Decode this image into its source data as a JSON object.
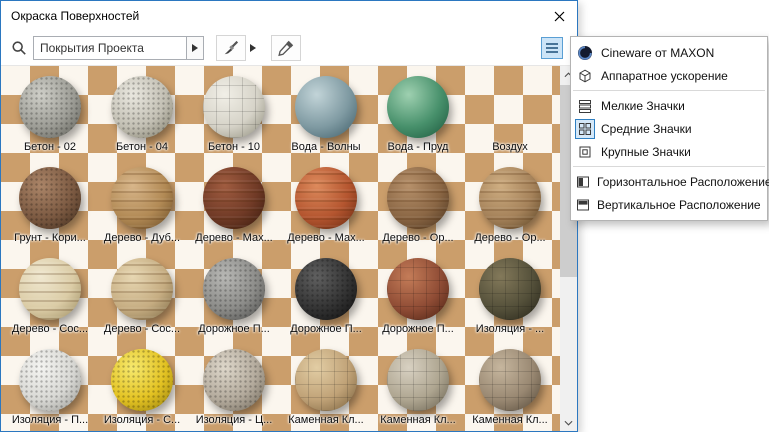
{
  "window": {
    "title": "Окраска Поверхностей"
  },
  "toolbar": {
    "search_value": "Покрытия Проекта"
  },
  "colors": {
    "accent": "#2b77c0",
    "checker_light": "#fbf6ee",
    "checker_dark": "#cb9e6b"
  },
  "materials": [
    {
      "label": "Бетон - 02",
      "light": "#cfcfc8",
      "base": "#9d9d96",
      "dark": "#63635c",
      "texture": "speckle"
    },
    {
      "label": "Бетон - 04",
      "light": "#e9e7df",
      "base": "#c3c0b4",
      "dark": "#84816f",
      "texture": "speckle"
    },
    {
      "label": "Бетон - 10",
      "light": "#f1efe7",
      "base": "#d6d3c8",
      "dark": "#92907f",
      "texture": "tiles"
    },
    {
      "label": "Вода - Волны",
      "light": "#c2d4d8",
      "base": "#7f9aa2",
      "dark": "#41606b"
    },
    {
      "label": "Вода - Пруд",
      "light": "#9ed0b0",
      "base": "#47906b",
      "dark": "#1e5a3f"
    },
    {
      "label": "Воздух",
      "transparent": true
    },
    {
      "label": "Грунт - Кори...",
      "light": "#ab8568",
      "base": "#7c5a42",
      "dark": "#45301f",
      "texture": "speckle"
    },
    {
      "label": "Дерево - Дуб...",
      "light": "#d8b68a",
      "base": "#b28a55",
      "dark": "#6e4f28",
      "texture": "stripes"
    },
    {
      "label": "Дерево - Мах...",
      "light": "#a05c40",
      "base": "#703a26",
      "dark": "#3a1b0e",
      "texture": "stripes"
    },
    {
      "label": "Дерево - Мах...",
      "light": "#dd8a5c",
      "base": "#b4552f",
      "dark": "#6b2a12",
      "texture": "stripes"
    },
    {
      "label": "Дерево - Ор...",
      "light": "#b6906a",
      "base": "#8a6644",
      "dark": "#4e3620",
      "texture": "stripes"
    },
    {
      "label": "Дерево - Ор...",
      "light": "#cfae82",
      "base": "#a5825a",
      "dark": "#604828",
      "texture": "stripes"
    },
    {
      "label": "Дерево - Сос...",
      "light": "#f0e8d0",
      "base": "#dbcca6",
      "dark": "#9e8e63",
      "texture": "stripes"
    },
    {
      "label": "Дерево - Сос...",
      "light": "#e7d7b2",
      "base": "#c6ad82",
      "dark": "#83704b",
      "texture": "stripes"
    },
    {
      "label": "Дорожное П...",
      "light": "#b8b8b5",
      "base": "#8c8c89",
      "dark": "#4f4f4d",
      "texture": "speckle"
    },
    {
      "label": "Дорожное П...",
      "light": "#606060",
      "base": "#333333",
      "dark": "#101010",
      "texture": "speckle"
    },
    {
      "label": "Дорожное П...",
      "light": "#c47c58",
      "base": "#8f4c35",
      "dark": "#4f2414",
      "texture": "tiles"
    },
    {
      "label": "Изоляция - ...",
      "light": "#83795a",
      "base": "#54503a",
      "dark": "#28261a",
      "texture": "tiles"
    },
    {
      "label": "Изоляция - П...",
      "light": "#f4f4f1",
      "base": "#d8d8d4",
      "dark": "#9c9c97",
      "texture": "speckle"
    },
    {
      "label": "Изоляция - С...",
      "light": "#f6e96e",
      "base": "#e3c222",
      "dark": "#97800f",
      "texture": "speckle"
    },
    {
      "label": "Изоляция - Ц...",
      "light": "#ded7ca",
      "base": "#b3aa9c",
      "dark": "#746c5e",
      "texture": "speckle"
    },
    {
      "label": "Каменная Кл...",
      "light": "#e2cda4",
      "base": "#c0a277",
      "dark": "#7c6440",
      "texture": "tiles"
    },
    {
      "label": "Каменная Кл...",
      "light": "#d8d1c2",
      "base": "#aea590",
      "dark": "#6b6453",
      "texture": "tiles"
    },
    {
      "label": "Каменная Кл...",
      "light": "#c6b69e",
      "base": "#998872",
      "dark": "#584c3c",
      "texture": "tiles"
    }
  ],
  "menu": {
    "items": [
      {
        "name": "cineware",
        "label": "Cineware от MAXON"
      },
      {
        "name": "hardware-acceleration",
        "label": "Аппаратное ускорение"
      },
      {
        "separator": true
      },
      {
        "name": "small-icons",
        "label": "Мелкие Значки"
      },
      {
        "name": "medium-icons",
        "label": "Средние Значки",
        "selected": true
      },
      {
        "name": "large-icons",
        "label": "Крупные Значки"
      },
      {
        "separator": true
      },
      {
        "name": "horizontal-layout",
        "label": "Горизонтальное Расположение"
      },
      {
        "name": "vertical-layout",
        "label": "Вертикальное Расположение"
      }
    ]
  }
}
